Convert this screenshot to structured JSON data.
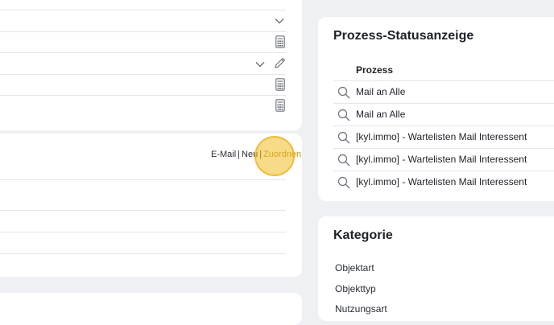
{
  "form_links": {
    "email": "E-Mail",
    "neu": "Neu",
    "zuordnen": "Zuordnen",
    "separator": "|"
  },
  "process_panel": {
    "title": "Prozess-Statusanzeige",
    "column_header": "Prozess",
    "rows": [
      "Mail an Alle",
      "Mail an Alle",
      "[kyl.immo] - Wartelisten Mail Interessent",
      "[kyl.immo] - Wartelisten Mail Interessent",
      "[kyl.immo] - Wartelisten Mail Interessent"
    ]
  },
  "category_panel": {
    "title": "Kategorie",
    "items": [
      "Objektart",
      "Objekttyp",
      "Nutzungsart"
    ]
  },
  "colors": {
    "background": "#eef0f4",
    "card": "#ffffff",
    "accent_link": "#c28a0e",
    "cursor_highlight": "#f3be28"
  }
}
